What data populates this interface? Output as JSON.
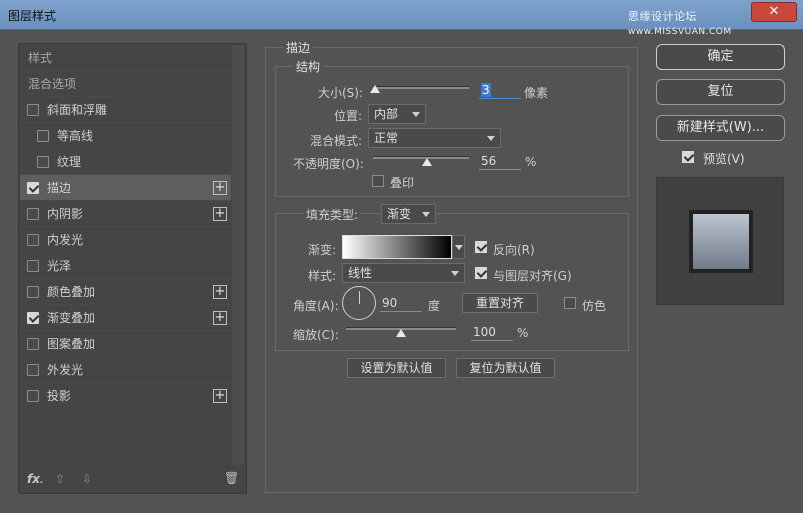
{
  "window": {
    "title": "图层样式",
    "watermark": "思缘设计论坛",
    "watermark_site": "www.MISSVUAN.COM",
    "close_glyph": "✕"
  },
  "styles_list": [
    {
      "label": "样式",
      "type": "header"
    },
    {
      "label": "混合选项",
      "type": "header"
    },
    {
      "label": "斜面和浮雕",
      "checked": false,
      "plus": false
    },
    {
      "label": "等高线",
      "checked": false,
      "indent": true
    },
    {
      "label": "纹理",
      "checked": false,
      "indent": true
    },
    {
      "label": "描边",
      "checked": true,
      "plus": true,
      "active": true
    },
    {
      "label": "内阴影",
      "checked": false,
      "plus": true
    },
    {
      "label": "内发光",
      "checked": false
    },
    {
      "label": "光泽",
      "checked": false
    },
    {
      "label": "颜色叠加",
      "checked": false,
      "plus": true
    },
    {
      "label": "渐变叠加",
      "checked": true,
      "plus": true
    },
    {
      "label": "图案叠加",
      "checked": false
    },
    {
      "label": "外发光",
      "checked": false
    },
    {
      "label": "投影",
      "checked": false,
      "plus": true
    }
  ],
  "bottom_tools": {
    "fx": "fx",
    "fx_sub": ".",
    "up": "⇧",
    "down": "⇩",
    "trash": "🗑"
  },
  "stroke": {
    "section_title": "描边",
    "structure_title": "结构",
    "size_label": "大小(S):",
    "size_value": "3",
    "size_unit": "像素",
    "position_label": "位置:",
    "position_value": "内部",
    "blend_label": "混合模式:",
    "blend_value": "正常",
    "opacity_label": "不透明度(O):",
    "opacity_value": "56",
    "opacity_unit": "%",
    "overprint_label": "叠印",
    "fill_type_label": "填充类型:",
    "fill_type_value": "渐变",
    "gradient_label": "渐变:",
    "reverse_label": "反向(R)",
    "reverse_checked": true,
    "style_label": "样式:",
    "style_value": "线性",
    "align_label": "与图层对齐(G)",
    "align_checked": true,
    "angle_label": "角度(A):",
    "angle_value": "90",
    "angle_unit": "度",
    "reset_align_label": "重置对齐",
    "dither_label": "仿色",
    "dither_checked": false,
    "scale_label": "缩放(C):",
    "scale_value": "100",
    "scale_unit": "%",
    "set_default_label": "设置为默认值",
    "reset_default_label": "复位为默认值"
  },
  "sliders": {
    "size_level": 0.02,
    "opacity_level": 0.56,
    "scale_level": 0.5
  },
  "buttons": {
    "ok": "确定",
    "reset": "复位",
    "new_style": "新建样式(W)...",
    "preview_label": "预览(V)",
    "preview_checked": true
  }
}
